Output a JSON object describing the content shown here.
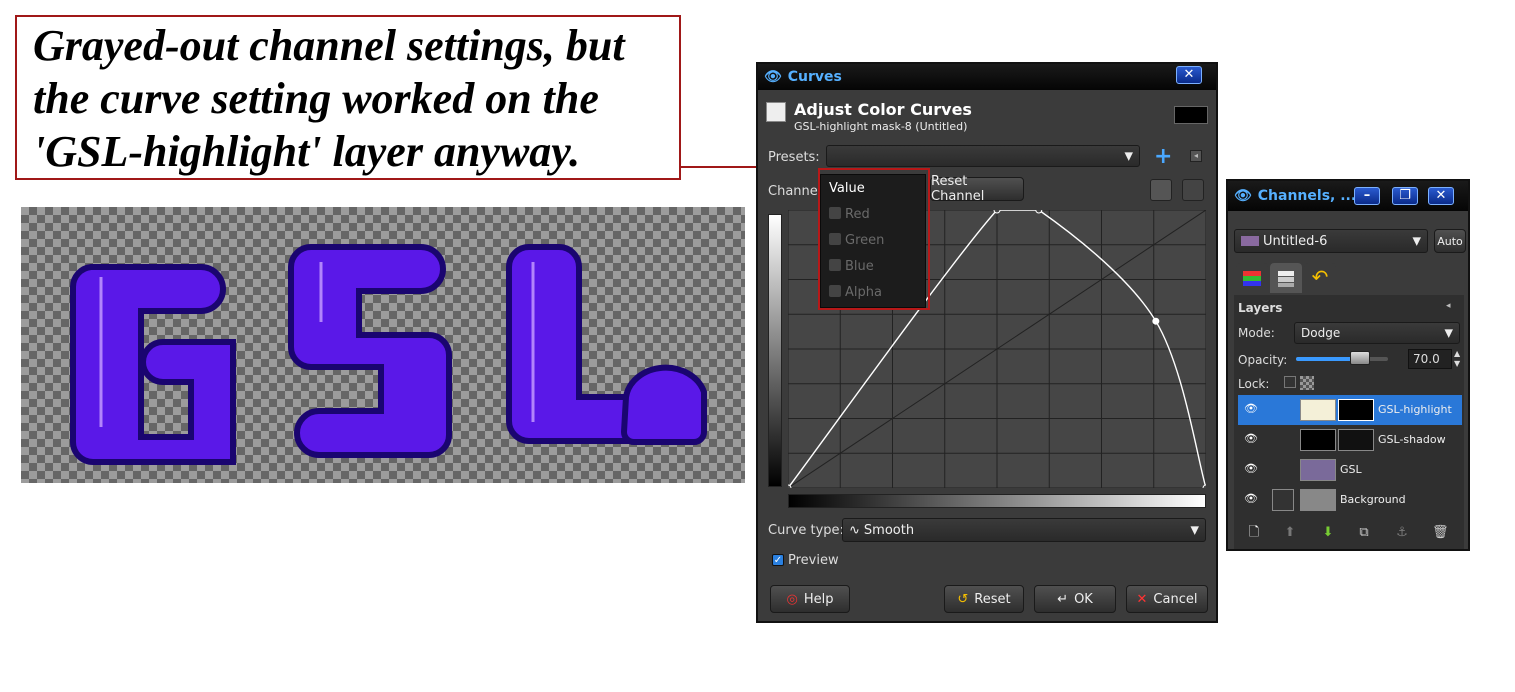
{
  "annotation": {
    "lines": [
      "Grayed-out channel settings, but",
      "the curve setting worked on the",
      "'GSL-highlight' layer anyway."
    ]
  },
  "canvas_text": "GSL.",
  "curves_dialog": {
    "window_title": "Curves",
    "header_title": "Adjust Color Curves",
    "header_subtitle": "GSL-highlight mask-8 (Untitled)",
    "presets_label": "Presets:",
    "presets_value": "",
    "channel_label": "Channel:",
    "reset_channel_label": "Reset Channel",
    "channel_menu": [
      {
        "label": "Value",
        "enabled": true
      },
      {
        "label": "Red",
        "enabled": false
      },
      {
        "label": "Green",
        "enabled": false
      },
      {
        "label": "Blue",
        "enabled": false
      },
      {
        "label": "Alpha",
        "enabled": false
      }
    ],
    "curve_type_label": "Curve type:",
    "curve_type_value": "Smooth",
    "preview_label": "Preview",
    "preview_checked": true,
    "help_label": "Help",
    "reset_label": "Reset",
    "ok_label": "OK",
    "cancel_label": "Cancel",
    "curve_points": [
      [
        0,
        0
      ],
      [
        0.5,
        1
      ],
      [
        0.6,
        1
      ],
      [
        0.88,
        0.6
      ],
      [
        1,
        0
      ]
    ]
  },
  "layers_dialog": {
    "window_title": "Channels, ...",
    "image_value": "Untitled-6",
    "auto_label": "Auto",
    "panel_title": "Layers",
    "mode_label": "Mode:",
    "mode_value": "Dodge",
    "opacity_label": "Opacity:",
    "opacity_value": "70.0",
    "opacity_fraction": 0.7,
    "lock_label": "Lock:",
    "layers": [
      {
        "name": "GSL-highlight",
        "selected": true
      },
      {
        "name": "GSL-shadow",
        "selected": false
      },
      {
        "name": "GSL",
        "selected": false
      },
      {
        "name": "Background",
        "selected": false
      }
    ]
  },
  "colors": {
    "annotation_border": "#a01818",
    "accent": "#56b0ff",
    "glyph_fill": "#5a18e8",
    "selection": "#2a78d8"
  }
}
